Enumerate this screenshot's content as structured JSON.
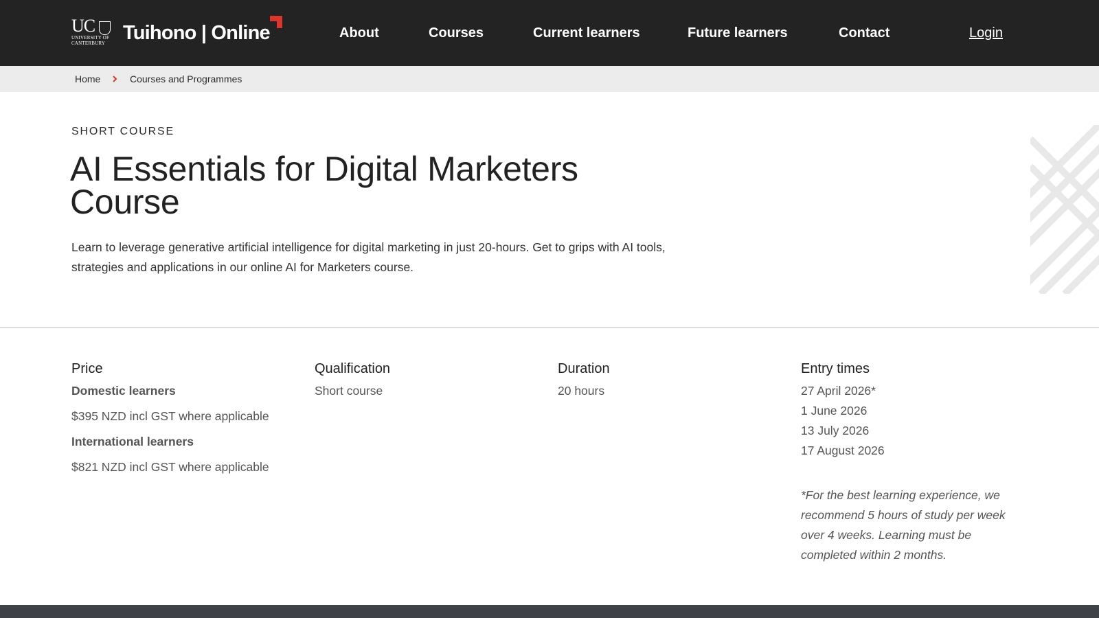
{
  "brand": {
    "university_short": "UC",
    "university_sub_1": "UNIVERSITY OF",
    "university_sub_2": "CANTERBURY",
    "site_name": "Tuihono | Online",
    "accent_color": "#d9372b"
  },
  "nav": {
    "items": [
      "About",
      "Courses",
      "Current learners",
      "Future learners",
      "Contact"
    ],
    "login": "Login"
  },
  "breadcrumb": {
    "items": [
      "Home",
      "Courses and Programmes"
    ]
  },
  "hero": {
    "eyebrow": "SHORT COURSE",
    "title": "AI Essentials for Digital Marketers Course",
    "lead": "Learn to leverage generative artificial intelligence for digital marketing in just 20-hours. Get to grips with AI tools, strategies and applications in our online AI for Marketers course."
  },
  "info": {
    "price": {
      "heading": "Price",
      "domestic_label": "Domestic learners",
      "domestic_value": "$395 NZD incl GST where applicable",
      "international_label": "International learners",
      "international_value": "$821 NZD incl GST where applicable"
    },
    "qualification": {
      "heading": "Qualification",
      "value": "Short course"
    },
    "duration": {
      "heading": "Duration",
      "value": "20 hours"
    },
    "entry": {
      "heading": "Entry times",
      "dates": [
        "27 April 2026*",
        "1 June 2026",
        "13 July 2026",
        "17 August 2026"
      ],
      "note": "*For the best learning experience, we recommend 5 hours of study per week over 4 weeks. Learning must be completed within 2 months."
    }
  }
}
